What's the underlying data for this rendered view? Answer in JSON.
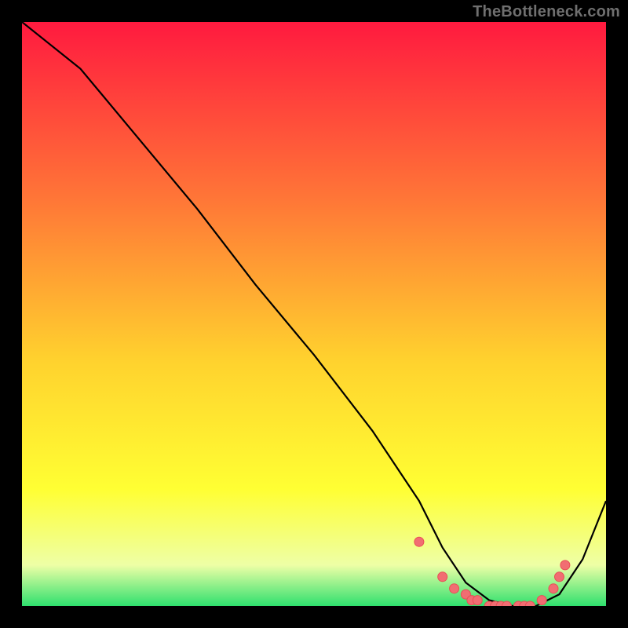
{
  "watermark": "TheBottleneck.com",
  "colors": {
    "black": "#000000",
    "curve": "#000000",
    "marker_fill": "#f16d72",
    "marker_stroke": "#e84e55",
    "grad_top": "#ff1a3f",
    "grad_mid1": "#ff7537",
    "grad_mid2": "#ffd22e",
    "grad_mid3": "#ffff33",
    "grad_mid4": "#eeffa6",
    "grad_bottom": "#2fe06e"
  },
  "chart_data": {
    "type": "line",
    "title": "",
    "xlabel": "",
    "ylabel": "",
    "xlim": [
      0,
      100
    ],
    "ylim": [
      0,
      100
    ],
    "x": [
      0,
      10,
      20,
      30,
      40,
      50,
      60,
      68,
      72,
      76,
      80,
      84,
      88,
      92,
      96,
      100
    ],
    "values": [
      100,
      92,
      80,
      68,
      55,
      43,
      30,
      18,
      10,
      4,
      1,
      0,
      0,
      2,
      8,
      18
    ],
    "markers_x": [
      68,
      72,
      74,
      76,
      77,
      78,
      80,
      81,
      82,
      83,
      85,
      86,
      87,
      89,
      91,
      92,
      93
    ],
    "markers_y": [
      11,
      5,
      3,
      2,
      1,
      1,
      0,
      0,
      0,
      0,
      0,
      0,
      0,
      1,
      3,
      5,
      7
    ]
  }
}
